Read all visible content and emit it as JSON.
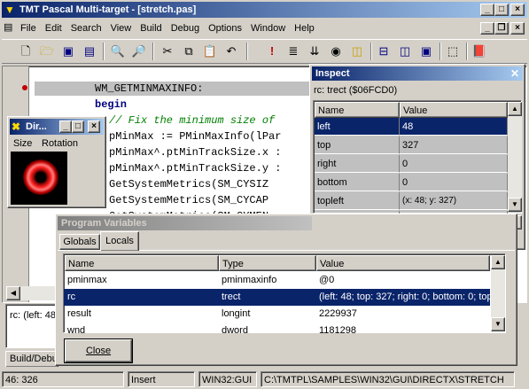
{
  "window": {
    "title": "TMT Pascal Multi-target - [stretch.pas]"
  },
  "menu": [
    "File",
    "Edit",
    "Search",
    "View",
    "Build",
    "Debug",
    "Options",
    "Window",
    "Help"
  ],
  "toolbar": [
    "new-file",
    "open-file",
    "save-file",
    "save-all",
    "print-preview",
    "find",
    "cut",
    "copy",
    "paste",
    "undo",
    "run",
    "step",
    "trace",
    "breakpoint",
    "watch",
    "tile-horizontal",
    "tile-vertical",
    "cascade",
    "inspect",
    "help-book"
  ],
  "editor": {
    "lines": [
      "WM_GETMINMAXINFO:",
      "begin",
      "  // Fix the minimum size of",
      "  pMinMax := PMinMaxInfo(lPar",
      "  pMinMax^.ptMinTrackSize.x :",
      "  pMinMax^.ptMinTrackSize.y :",
      "    GetSystemMetrics(SM_CYSIZ",
      "    GetSystemMetrics(SM_CYCAP",
      "    GetSystemMetrics(SM_CYMEN"
    ],
    "message": "rc: (left: 48"
  },
  "dir_window": {
    "title": "Dir...",
    "menu": [
      "Size",
      "Rotation"
    ]
  },
  "inspect": {
    "title": "Inspect",
    "expression": "rc: trect ($06FCD0)",
    "headers": [
      "Name",
      "Value"
    ],
    "rows": [
      {
        "name": "left",
        "value": "48"
      },
      {
        "name": "top",
        "value": "327"
      },
      {
        "name": "right",
        "value": "0"
      },
      {
        "name": "bottom",
        "value": "0"
      },
      {
        "name": "topleft",
        "value": "(x: 48; y: 327)"
      },
      {
        "name": "bottomright",
        "value": "(x: 0; y: 0)"
      }
    ]
  },
  "program_variables": {
    "title": "Program Variables",
    "tabs": [
      "Globals",
      "Locals"
    ],
    "headers": [
      "Name",
      "Type",
      "Value"
    ],
    "rows": [
      {
        "name": "pminmax",
        "type": "pminmaxinfo",
        "value": "@0"
      },
      {
        "name": "rc",
        "type": "trect",
        "value": "(left: 48; top: 327; right: 0; bottom: 0; topleft:"
      },
      {
        "name": "result",
        "type": "longint",
        "value": "2229937"
      },
      {
        "name": "wnd",
        "type": "dword",
        "value": "1181298"
      }
    ],
    "close_label": "Close"
  },
  "bottom_tab": "Build/Debu",
  "status": {
    "position": "46: 326",
    "mode": "Insert",
    "target": "WIN32:GUI",
    "path": "C:\\TMTPL\\SAMPLES\\WIN32\\GUI\\DIRECTX\\STRETCH"
  },
  "colors": {
    "title_active": "#0a246a",
    "title_gradient": "#a6caf0",
    "selection": "#0a246a",
    "breakpoint": "#c00000",
    "keyword": "#000080",
    "comment": "#008000"
  }
}
